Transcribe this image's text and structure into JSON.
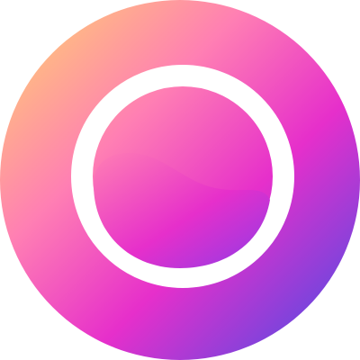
{
  "icon": {
    "name": "app-logo-icon",
    "colors": {
      "gradient_start": "#FFD86B",
      "gradient_mid_1": "#FF7FB3",
      "gradient_mid_2": "#E62FCB",
      "gradient_end": "#3E4FE6",
      "ring": "#FFFFFF",
      "background": "#FFFFFF"
    }
  }
}
